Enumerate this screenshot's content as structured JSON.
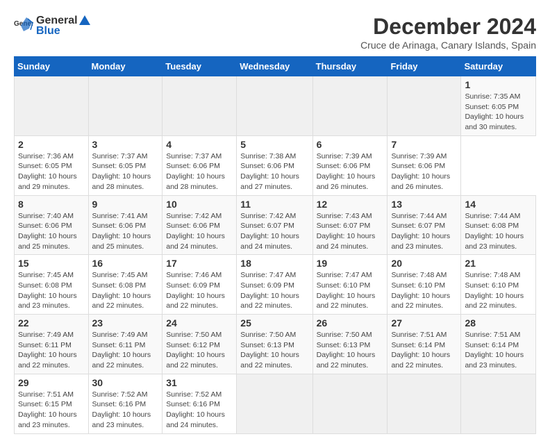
{
  "header": {
    "logo_general": "General",
    "logo_blue": "Blue",
    "title": "December 2024",
    "subtitle": "Cruce de Arinaga, Canary Islands, Spain"
  },
  "calendar": {
    "days_of_week": [
      "Sunday",
      "Monday",
      "Tuesday",
      "Wednesday",
      "Thursday",
      "Friday",
      "Saturday"
    ],
    "weeks": [
      [
        {
          "day": "",
          "info": ""
        },
        {
          "day": "",
          "info": ""
        },
        {
          "day": "",
          "info": ""
        },
        {
          "day": "",
          "info": ""
        },
        {
          "day": "",
          "info": ""
        },
        {
          "day": "",
          "info": ""
        },
        {
          "day": "1",
          "info": "Sunrise: 7:35 AM\nSunset: 6:05 PM\nDaylight: 10 hours and 30 minutes."
        }
      ],
      [
        {
          "day": "2",
          "info": "Sunrise: 7:36 AM\nSunset: 6:05 PM\nDaylight: 10 hours and 29 minutes."
        },
        {
          "day": "3",
          "info": "Sunrise: 7:37 AM\nSunset: 6:05 PM\nDaylight: 10 hours and 28 minutes."
        },
        {
          "day": "4",
          "info": "Sunrise: 7:37 AM\nSunset: 6:06 PM\nDaylight: 10 hours and 28 minutes."
        },
        {
          "day": "5",
          "info": "Sunrise: 7:38 AM\nSunset: 6:06 PM\nDaylight: 10 hours and 27 minutes."
        },
        {
          "day": "6",
          "info": "Sunrise: 7:39 AM\nSunset: 6:06 PM\nDaylight: 10 hours and 26 minutes."
        },
        {
          "day": "7",
          "info": "Sunrise: 7:39 AM\nSunset: 6:06 PM\nDaylight: 10 hours and 26 minutes."
        }
      ],
      [
        {
          "day": "8",
          "info": "Sunrise: 7:40 AM\nSunset: 6:06 PM\nDaylight: 10 hours and 25 minutes."
        },
        {
          "day": "9",
          "info": "Sunrise: 7:41 AM\nSunset: 6:06 PM\nDaylight: 10 hours and 25 minutes."
        },
        {
          "day": "10",
          "info": "Sunrise: 7:42 AM\nSunset: 6:06 PM\nDaylight: 10 hours and 24 minutes."
        },
        {
          "day": "11",
          "info": "Sunrise: 7:42 AM\nSunset: 6:07 PM\nDaylight: 10 hours and 24 minutes."
        },
        {
          "day": "12",
          "info": "Sunrise: 7:43 AM\nSunset: 6:07 PM\nDaylight: 10 hours and 24 minutes."
        },
        {
          "day": "13",
          "info": "Sunrise: 7:44 AM\nSunset: 6:07 PM\nDaylight: 10 hours and 23 minutes."
        },
        {
          "day": "14",
          "info": "Sunrise: 7:44 AM\nSunset: 6:08 PM\nDaylight: 10 hours and 23 minutes."
        }
      ],
      [
        {
          "day": "15",
          "info": "Sunrise: 7:45 AM\nSunset: 6:08 PM\nDaylight: 10 hours and 23 minutes."
        },
        {
          "day": "16",
          "info": "Sunrise: 7:45 AM\nSunset: 6:08 PM\nDaylight: 10 hours and 22 minutes."
        },
        {
          "day": "17",
          "info": "Sunrise: 7:46 AM\nSunset: 6:09 PM\nDaylight: 10 hours and 22 minutes."
        },
        {
          "day": "18",
          "info": "Sunrise: 7:47 AM\nSunset: 6:09 PM\nDaylight: 10 hours and 22 minutes."
        },
        {
          "day": "19",
          "info": "Sunrise: 7:47 AM\nSunset: 6:10 PM\nDaylight: 10 hours and 22 minutes."
        },
        {
          "day": "20",
          "info": "Sunrise: 7:48 AM\nSunset: 6:10 PM\nDaylight: 10 hours and 22 minutes."
        },
        {
          "day": "21",
          "info": "Sunrise: 7:48 AM\nSunset: 6:10 PM\nDaylight: 10 hours and 22 minutes."
        }
      ],
      [
        {
          "day": "22",
          "info": "Sunrise: 7:49 AM\nSunset: 6:11 PM\nDaylight: 10 hours and 22 minutes."
        },
        {
          "day": "23",
          "info": "Sunrise: 7:49 AM\nSunset: 6:11 PM\nDaylight: 10 hours and 22 minutes."
        },
        {
          "day": "24",
          "info": "Sunrise: 7:50 AM\nSunset: 6:12 PM\nDaylight: 10 hours and 22 minutes."
        },
        {
          "day": "25",
          "info": "Sunrise: 7:50 AM\nSunset: 6:13 PM\nDaylight: 10 hours and 22 minutes."
        },
        {
          "day": "26",
          "info": "Sunrise: 7:50 AM\nSunset: 6:13 PM\nDaylight: 10 hours and 22 minutes."
        },
        {
          "day": "27",
          "info": "Sunrise: 7:51 AM\nSunset: 6:14 PM\nDaylight: 10 hours and 22 minutes."
        },
        {
          "day": "28",
          "info": "Sunrise: 7:51 AM\nSunset: 6:14 PM\nDaylight: 10 hours and 23 minutes."
        }
      ],
      [
        {
          "day": "29",
          "info": "Sunrise: 7:51 AM\nSunset: 6:15 PM\nDaylight: 10 hours and 23 minutes."
        },
        {
          "day": "30",
          "info": "Sunrise: 7:52 AM\nSunset: 6:16 PM\nDaylight: 10 hours and 23 minutes."
        },
        {
          "day": "31",
          "info": "Sunrise: 7:52 AM\nSunset: 6:16 PM\nDaylight: 10 hours and 24 minutes."
        },
        {
          "day": "",
          "info": ""
        },
        {
          "day": "",
          "info": ""
        },
        {
          "day": "",
          "info": ""
        },
        {
          "day": "",
          "info": ""
        }
      ]
    ]
  }
}
